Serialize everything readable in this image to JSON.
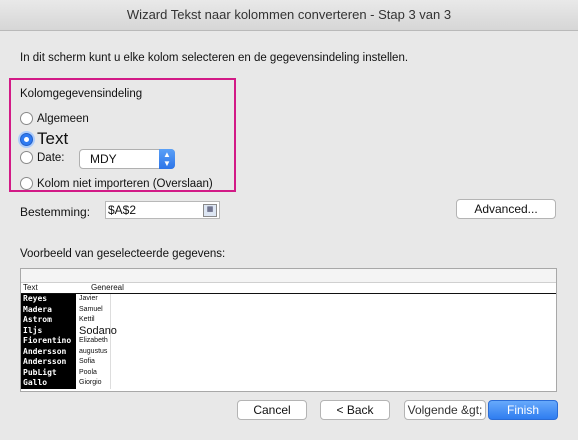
{
  "window": {
    "title": "Wizard Tekst naar kolommen converteren - Stap 3 van 3"
  },
  "instruction": "In dit scherm kunt u elke kolom selecteren en de gegevensindeling instellen.",
  "format_section": {
    "label": "Kolomgegevensindeling",
    "options": {
      "general": "Algemeen",
      "text": "Text",
      "date": "Date:",
      "skip": "Kolom niet importeren (Overslaan)"
    },
    "selected": "text",
    "date_format": "MDY"
  },
  "destination": {
    "label": "Bestemming:",
    "value": "$A$2"
  },
  "buttons": {
    "advanced": "Advanced...",
    "cancel": "Cancel",
    "back": "< Back",
    "next": "Volgende &gt;",
    "finish": "Finish"
  },
  "preview": {
    "label": "Voorbeeld van geselecteerde gegevens:",
    "headers": [
      "Text",
      "Genereal"
    ],
    "rows": [
      [
        "Reyes",
        "Javier"
      ],
      [
        "Madera",
        "Samuel"
      ],
      [
        "Astrom",
        "Kettil"
      ],
      [
        "Iljs",
        "Sodano"
      ],
      [
        "Fiorentino",
        "Elizabeth"
      ],
      [
        "Andersson",
        "augustus"
      ],
      [
        "Andersson",
        "Sofia"
      ],
      [
        "PubLigt",
        "Poola"
      ],
      [
        "Gallo",
        "Giorgio"
      ]
    ]
  },
  "colors": {
    "highlight": "#d21a86",
    "accent": "#2f7df0"
  }
}
